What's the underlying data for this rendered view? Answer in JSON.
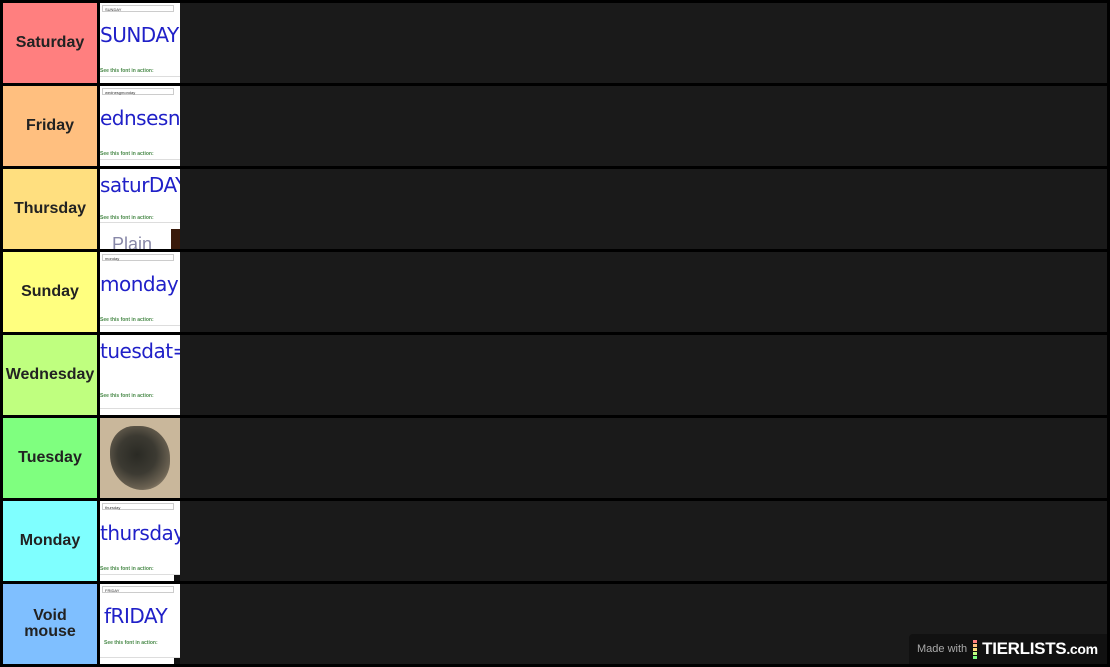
{
  "tiers": [
    {
      "label": "Saturday",
      "color": "#ff7f7f",
      "item": {
        "type": "font-sample",
        "field_text": "SUNDAY",
        "sample_text": "SUNDAY",
        "caption": "See this font in action:"
      }
    },
    {
      "label": "Friday",
      "color": "#ffbf7f",
      "item": {
        "type": "font-sample",
        "field_text": "wednesgmonday",
        "sample_text": "ednsesne",
        "caption": "See this font in action:"
      }
    },
    {
      "label": "Thursday",
      "color": "#ffdf7f",
      "item": {
        "type": "font-sample",
        "field_text": "",
        "sample_text": "saturDAY",
        "caption": "See this font in action:",
        "extra_text": "Plain"
      }
    },
    {
      "label": "Sunday",
      "color": "#ffff7f",
      "item": {
        "type": "font-sample",
        "field_text": "monday",
        "sample_text": "monday",
        "caption": "See this font in action:"
      }
    },
    {
      "label": "Wednesday",
      "color": "#bfff7f",
      "item": {
        "type": "font-sample",
        "field_text": "",
        "sample_text": "tuesdat=",
        "caption": "See this font in action:"
      }
    },
    {
      "label": "Tuesday",
      "color": "#7fff7f",
      "item": {
        "type": "artwork",
        "description": "dark shaggy creature drawing"
      }
    },
    {
      "label": "Monday",
      "color": "#7fffff",
      "item": {
        "type": "font-sample",
        "field_text": "thursday",
        "sample_text": "thursday",
        "caption": "See this font in action:"
      }
    },
    {
      "label": "Void mouse",
      "color": "#7fbfff",
      "item": {
        "type": "font-sample",
        "field_text": "FRIDAY",
        "sample_text": "fRIDAY",
        "caption": "See this font in action:"
      }
    }
  ],
  "watermark": {
    "prefix": "Made with",
    "brand": "TIERLISTS",
    "suffix": ".com",
    "bar_colors": [
      "#ff7f7f",
      "#ffbf7f",
      "#ffdf7f",
      "#bfff7f",
      "#7fff7f"
    ]
  }
}
